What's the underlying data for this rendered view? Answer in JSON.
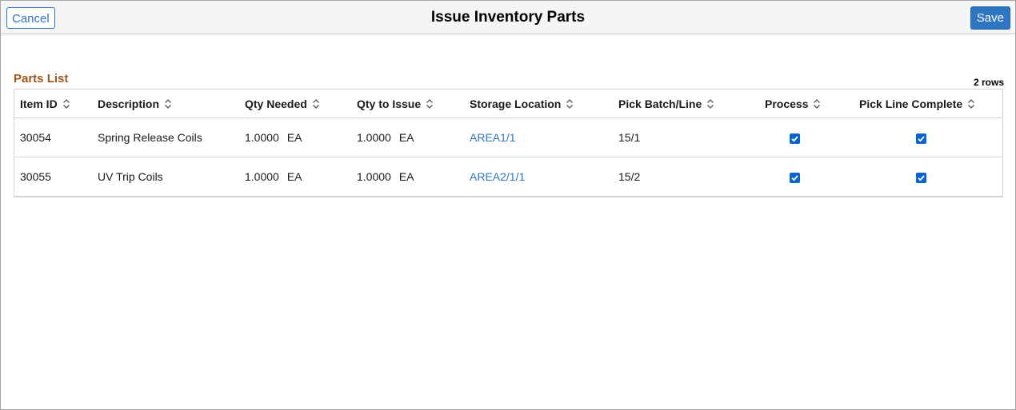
{
  "header": {
    "cancel_label": "Cancel",
    "title": "Issue Inventory Parts",
    "save_label": "Save"
  },
  "parts_list": {
    "section_title": "Parts List",
    "row_count": "2 rows",
    "columns": [
      "Item ID",
      "Description",
      "Qty Needed",
      "Qty to Issue",
      "Storage Location",
      "Pick Batch/Line",
      "Process",
      "Pick Line Complete"
    ],
    "rows": [
      {
        "item_id": "30054",
        "description": "Spring Release Coils",
        "qty_needed": "1.0000",
        "qty_needed_unit": "EA",
        "qty_to_issue": "1.0000",
        "qty_to_issue_unit": "EA",
        "storage_location": "AREA1/1",
        "pick_batch_line": "15/1",
        "process": true,
        "pick_line_complete": true
      },
      {
        "item_id": "30055",
        "description": "UV Trip Coils",
        "qty_needed": "1.0000",
        "qty_needed_unit": "EA",
        "qty_to_issue": "1.0000",
        "qty_to_issue_unit": "EA",
        "storage_location": "AREA2/1/1",
        "pick_batch_line": "15/2",
        "process": true,
        "pick_line_complete": true
      }
    ]
  },
  "icons": {
    "sort": "sort-icon",
    "checkbox": "checkbox-checked-icon"
  },
  "colors": {
    "accent": "#2e75c2",
    "section_title": "#a0571c",
    "checkbox": "#0b63cf"
  }
}
